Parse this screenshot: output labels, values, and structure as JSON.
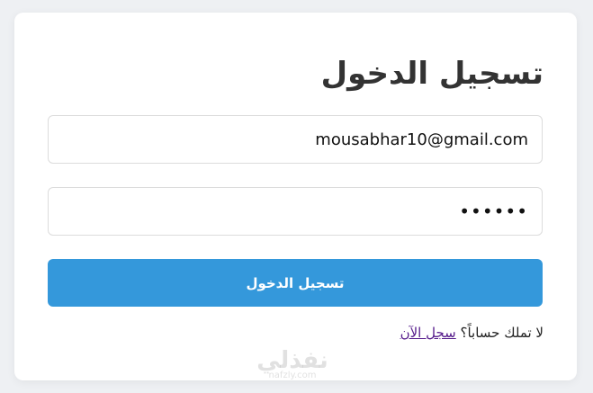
{
  "login": {
    "title": "تسجيل الدخول",
    "email_value": "mousabhar10@gmail.com",
    "password_value": "••••••",
    "submit_label": "تسجيل الدخول",
    "no_account_text": "لا تملك حساباً؟",
    "signup_link": "سجل الآن"
  },
  "watermark": {
    "text": "نفذلي",
    "subtext": "nafzly.com"
  },
  "colors": {
    "accent": "#3498db",
    "link": "#551a8b",
    "background": "#eef0f3",
    "card": "#ffffff"
  }
}
